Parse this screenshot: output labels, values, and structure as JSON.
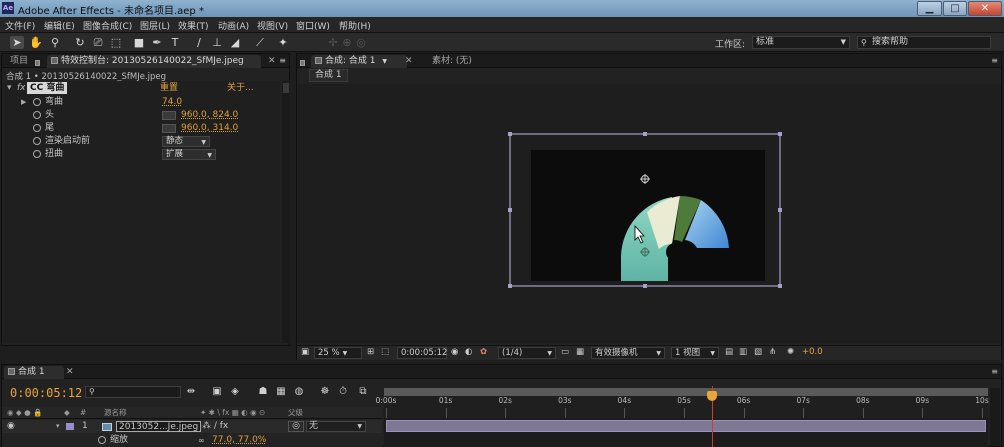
{
  "window": {
    "app_icon": "Ae",
    "title": "Adobe After Effects - 未命名项目.aep *",
    "minimize_glyph": "▁",
    "maximize_glyph": "□",
    "close_glyph": "✕"
  },
  "menu": [
    "文件(F)",
    "编辑(E)",
    "图像合成(C)",
    "图层(L)",
    "效果(T)",
    "动画(A)",
    "视图(V)",
    "窗口(W)",
    "帮助(H)"
  ],
  "toolbar": {
    "workspace_label": "工作区:",
    "workspace_value": "标准",
    "help_placeholder": "搜索帮助"
  },
  "effects_panel": {
    "tab_project": "项目",
    "tab_effects": "特效控制台: 20130526140022_SfMJe.jpeg",
    "subtitle": "合成 1 • 20130526140022_SfMJe.jpeg",
    "effect_name": "CC 弯曲",
    "reset_label": "重置",
    "about_label": "关于...",
    "props": {
      "bend_label": "弯曲",
      "bend_value": "74.0",
      "start_label": "头",
      "start_value": "960.0, 824.0",
      "end_label": "尾",
      "end_value": "960.0, 314.0",
      "render_prestart_label": "渲染启动前",
      "render_prestart_value": "静态",
      "distort_label": "扭曲",
      "distort_value": "扩展"
    }
  },
  "comp_panel": {
    "tab_comp": "合成: 合成 1",
    "tab_footage": "素材: (无)",
    "subtab": "合成 1",
    "viewer_bar": {
      "zoom": "25 %",
      "timecode": "0:00:05:12",
      "resolution": "(1/4)",
      "camera": "有效摄像机",
      "views": "1 视图",
      "exposure": "+0.0"
    }
  },
  "timeline": {
    "tab": "合成 1",
    "current_time": "0:00:05:12",
    "search_placeholder": "",
    "header": {
      "source_name": "源名称",
      "parent": "父级"
    },
    "layer": {
      "index": "1",
      "name": "2013052...Je.jpeg",
      "parent": "无"
    },
    "property": {
      "name": "缩放",
      "value": "77.0, 77.0%"
    },
    "ruler": {
      "labels": [
        "0:00s",
        "01s",
        "02s",
        "03s",
        "04s",
        "05s",
        "06s",
        "07s",
        "08s",
        "09s",
        "10s"
      ],
      "duration_seconds": 10,
      "current_seconds": 5.48
    }
  }
}
